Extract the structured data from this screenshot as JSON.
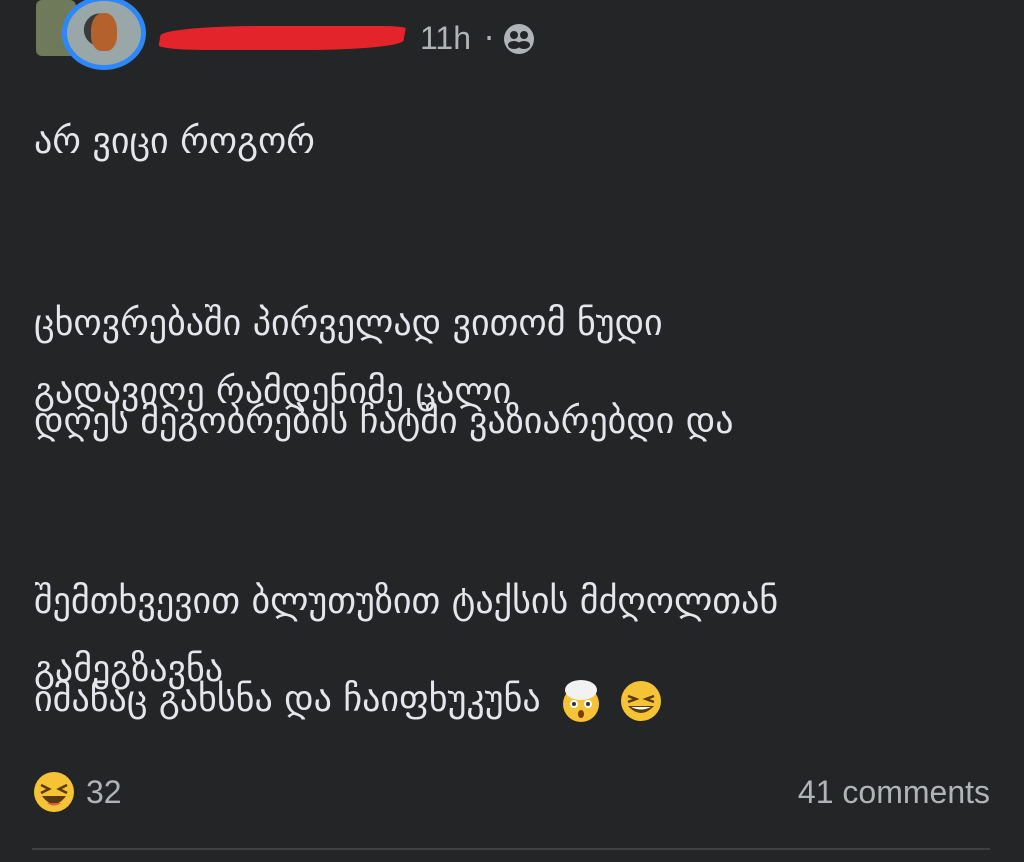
{
  "post": {
    "author_name": "",
    "timestamp": "11h",
    "separator": "·",
    "audience_icon": "friends-icon",
    "paragraphs": [
      "არ ვიცი როგორ",
      "ცხოვრებაში პირველად ვითომ ნუდი\nგადავიღე რამდენიმე ცალი",
      "დღეს მეგობრების ჩატში ვაზიარებდი და",
      "შემთხვევით ბლუთუზით ტაქსის მძღოლთან\nგამეგზავნა",
      "იმანაც გახსნა და ჩაიფხუკუნა"
    ],
    "inline_emojis": [
      "exploding-head",
      "laughing"
    ]
  },
  "footer": {
    "reaction_icon": "haha-reaction-icon",
    "reaction_count": "32",
    "comments_label": "41 comments"
  },
  "colors": {
    "background": "#242526",
    "text": "#e4e6eb",
    "secondary_text": "#b0b3b8",
    "avatar_ring": "#2d88ff",
    "redaction": "#e3242b"
  }
}
